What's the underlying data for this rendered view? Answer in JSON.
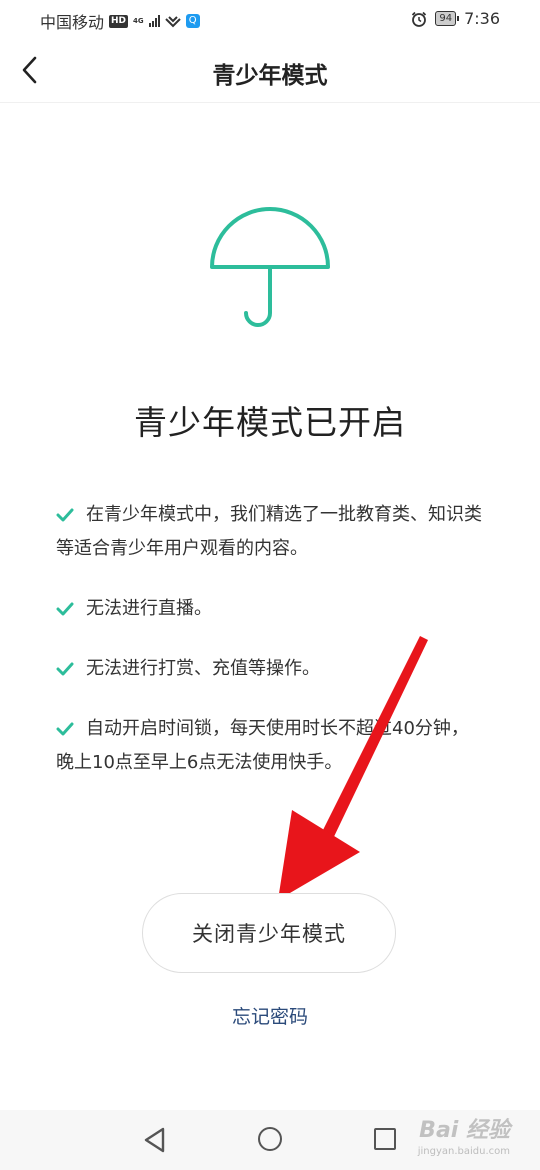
{
  "status_bar": {
    "carrier": "中国移动",
    "hd": "HD",
    "network": "4G",
    "battery": "94",
    "time": "7:36"
  },
  "nav": {
    "title": "青少年模式"
  },
  "content": {
    "headline": "青少年模式已开启",
    "items": [
      "在青少年模式中，我们精选了一批教育类、知识类等适合青少年用户观看的内容。",
      "无法进行直播。",
      "无法进行打赏、充值等操作。",
      "自动开启时间锁，每天使用时长不超过40分钟，晚上10点至早上6点无法使用快手。"
    ]
  },
  "actions": {
    "close_button": "关闭青少年模式",
    "forgot_password": "忘记密码"
  },
  "watermark": {
    "text": "Bai 经验",
    "sub": "jingyan.baidu.com"
  },
  "colors": {
    "accent": "#2dbd9b",
    "link": "#2b4a7a",
    "annotation": "#e8151b"
  },
  "icons": [
    "back-chevron-icon",
    "umbrella-icon",
    "check-icon",
    "nav-back-triangle-icon",
    "home-circle-icon",
    "recent-square-icon",
    "alarm-icon"
  ]
}
